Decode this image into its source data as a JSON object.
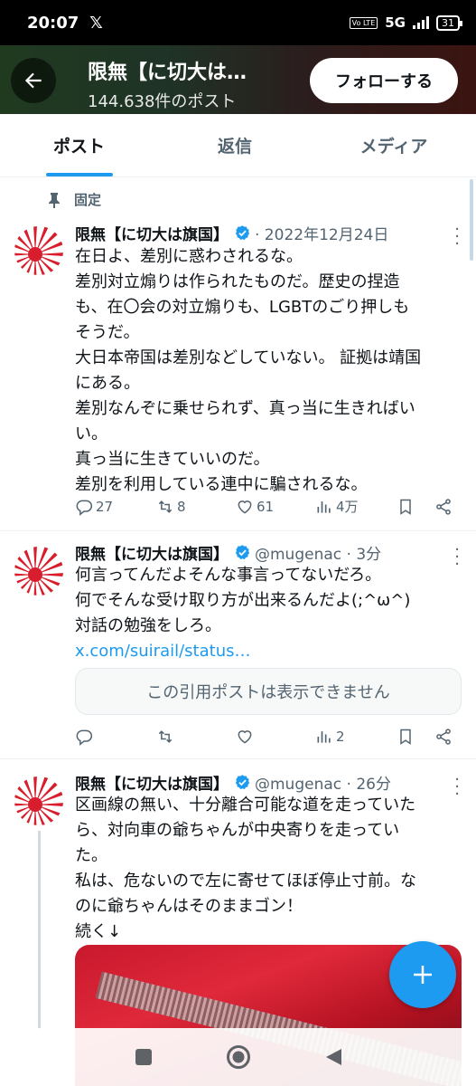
{
  "status_bar": {
    "time": "20:07",
    "x_logo": "𝕏",
    "volte": "Vo LTE",
    "network": "5G",
    "battery": "31"
  },
  "header": {
    "title": "限無【に切大は…",
    "post_count": "144.638件のポスト",
    "follow_label": "フォローする"
  },
  "tabs": [
    {
      "label": "ポスト",
      "active": true
    },
    {
      "label": "返信",
      "active": false
    },
    {
      "label": "メディア",
      "active": false
    }
  ],
  "pinned_label": "固定",
  "posts": [
    {
      "name": "限無【に切大は旗国】",
      "meta": "· 2022年12月24日",
      "lines": [
        "在日よ、差別に惑わされるな。",
        "差別対立煽りは作られたものだ。歴史の捏造",
        "も、在〇会の対立煽りも、LGBTのごり押しも",
        "そうだ。",
        "大日本帝国は差別などしていない。 証拠は靖国",
        "にある。",
        "差別なんぞに乗せられず、真っ当に生きればい",
        "い。",
        "真っ当に生きていいのだ。",
        "差別を利用している連中に騙されるな。"
      ],
      "replies": "27",
      "reposts": "8",
      "likes": "61",
      "views": "4万"
    },
    {
      "name": "限無【に切大は旗国】",
      "meta": "@mugenac · 3分",
      "lines": [
        "何言ってんだよそんな事言ってないだろ。",
        "何でそんな受け取り方が出来るんだよ(;^ω^)",
        "対話の勉強をしろ。"
      ],
      "link": "x.com/suirail/status…",
      "quote": "この引用ポストは表示できません",
      "replies": "",
      "reposts": "",
      "likes": "",
      "views": "2"
    },
    {
      "name": "限無【に切大は旗国】",
      "meta": "@mugenac · 26分",
      "lines": [
        "区画線の無い、十分離合可能な道を走っていた",
        "ら、対向車の爺ちゃんが中央寄りを走ってい",
        "た。",
        "私は、危ないので左に寄せてほぼ停止寸前。な",
        "のに爺ちゃんはそのままゴン！",
        "続く↓"
      ]
    }
  ],
  "colors": {
    "accent": "#1d9bf0",
    "text": "#0f1419",
    "muted": "#536471"
  }
}
